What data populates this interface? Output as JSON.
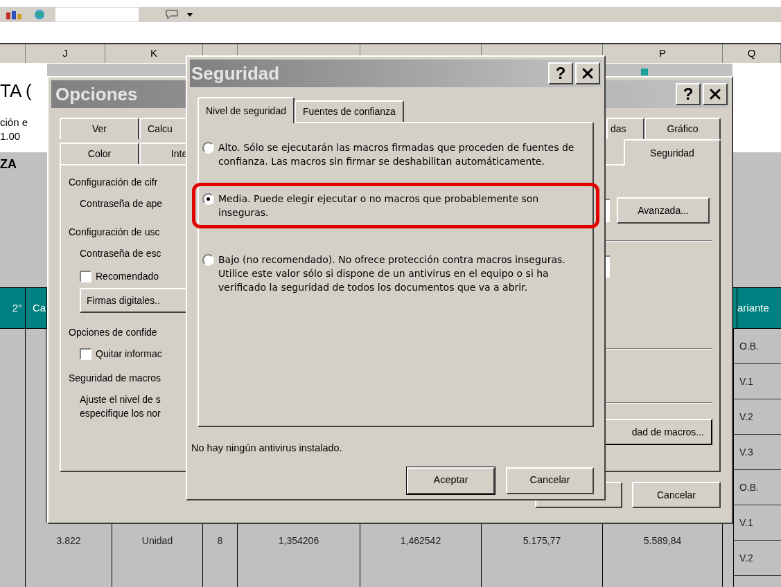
{
  "sheet": {
    "column_headers": [
      "J",
      "K",
      "P",
      "Q"
    ],
    "title_fragment": "TA (",
    "subtitle_lines": [
      "ción e",
      "1.00"
    ],
    "section_fragment": "ZA",
    "left_headers": [
      "2°",
      "Ca"
    ],
    "right_header": "ariante",
    "variant_cells": [
      "O.B.",
      "V.1",
      "V.2",
      "V.3",
      "O.B.",
      "V.1",
      "V.2"
    ],
    "data_row": [
      "3.822",
      "Unidad",
      "8",
      "1,354206",
      "1,462542",
      "5.175,77",
      "5.589,84"
    ]
  },
  "options_dialog": {
    "title": "Opciones",
    "help_button": "?",
    "tabs_row_1": [
      {
        "label": "Ver",
        "selected": false
      },
      {
        "label": "Calcu",
        "selected": false
      },
      {
        "label": "das",
        "selected": false
      },
      {
        "label": "Gráfico",
        "selected": false
      }
    ],
    "tabs_row_2": [
      {
        "label": "Color",
        "selected": false
      },
      {
        "label": "Inte",
        "selected": false
      },
      {
        "label": "Seguridad",
        "selected": true
      }
    ],
    "items": [
      {
        "kind": "heading",
        "text": "Configuración de cifr"
      },
      {
        "kind": "label",
        "text": "Contraseña de ape"
      },
      {
        "kind": "heading",
        "text": "Configuración de usc"
      },
      {
        "kind": "label",
        "text": "Contraseña de esc"
      },
      {
        "kind": "checkbox",
        "text": "Recomendado",
        "checked": false
      },
      {
        "kind": "button",
        "text": "Firmas digitales.."
      },
      {
        "kind": "heading",
        "text": "Opciones de confide"
      },
      {
        "kind": "checkbox",
        "text": "Quitar informac",
        "checked": false
      },
      {
        "kind": "heading",
        "text": "Seguridad de macros"
      },
      {
        "kind": "note",
        "lines": [
          "Ajuste el nivel de s",
          "especifique los nor"
        ]
      }
    ],
    "advanced_button": "Avanzada...",
    "macro_button": "dad de macros...",
    "cancel_button": "Cancelar"
  },
  "security_dialog": {
    "title": "Seguridad",
    "help_button": "?",
    "tabs": [
      {
        "label": "Nivel de seguridad",
        "selected": true
      },
      {
        "label": "Fuentes de confianza",
        "selected": false
      }
    ],
    "options": [
      {
        "text": "Alto. Sólo se ejecutarán las macros firmadas que proceden de fuentes de confianza. Las macros sin firmar se deshabilitan automáticamente.",
        "selected": false,
        "highlighted": false
      },
      {
        "text": "Media. Puede elegir ejecutar o no macros que probablemente son inseguras.",
        "selected": true,
        "highlighted": true
      },
      {
        "text": "Bajo (no recomendado). No ofrece protección contra macros inseguras. Utilice este valor sólo si dispone de un antivirus en el equipo o si ha verificado la seguridad de todos los documentos que va a abrir.",
        "selected": false,
        "highlighted": false
      }
    ],
    "status": "No hay ningún antivirus instalado.",
    "buttons": [
      {
        "label": "Aceptar",
        "default": true
      },
      {
        "label": "Cancelar",
        "default": false
      }
    ]
  }
}
